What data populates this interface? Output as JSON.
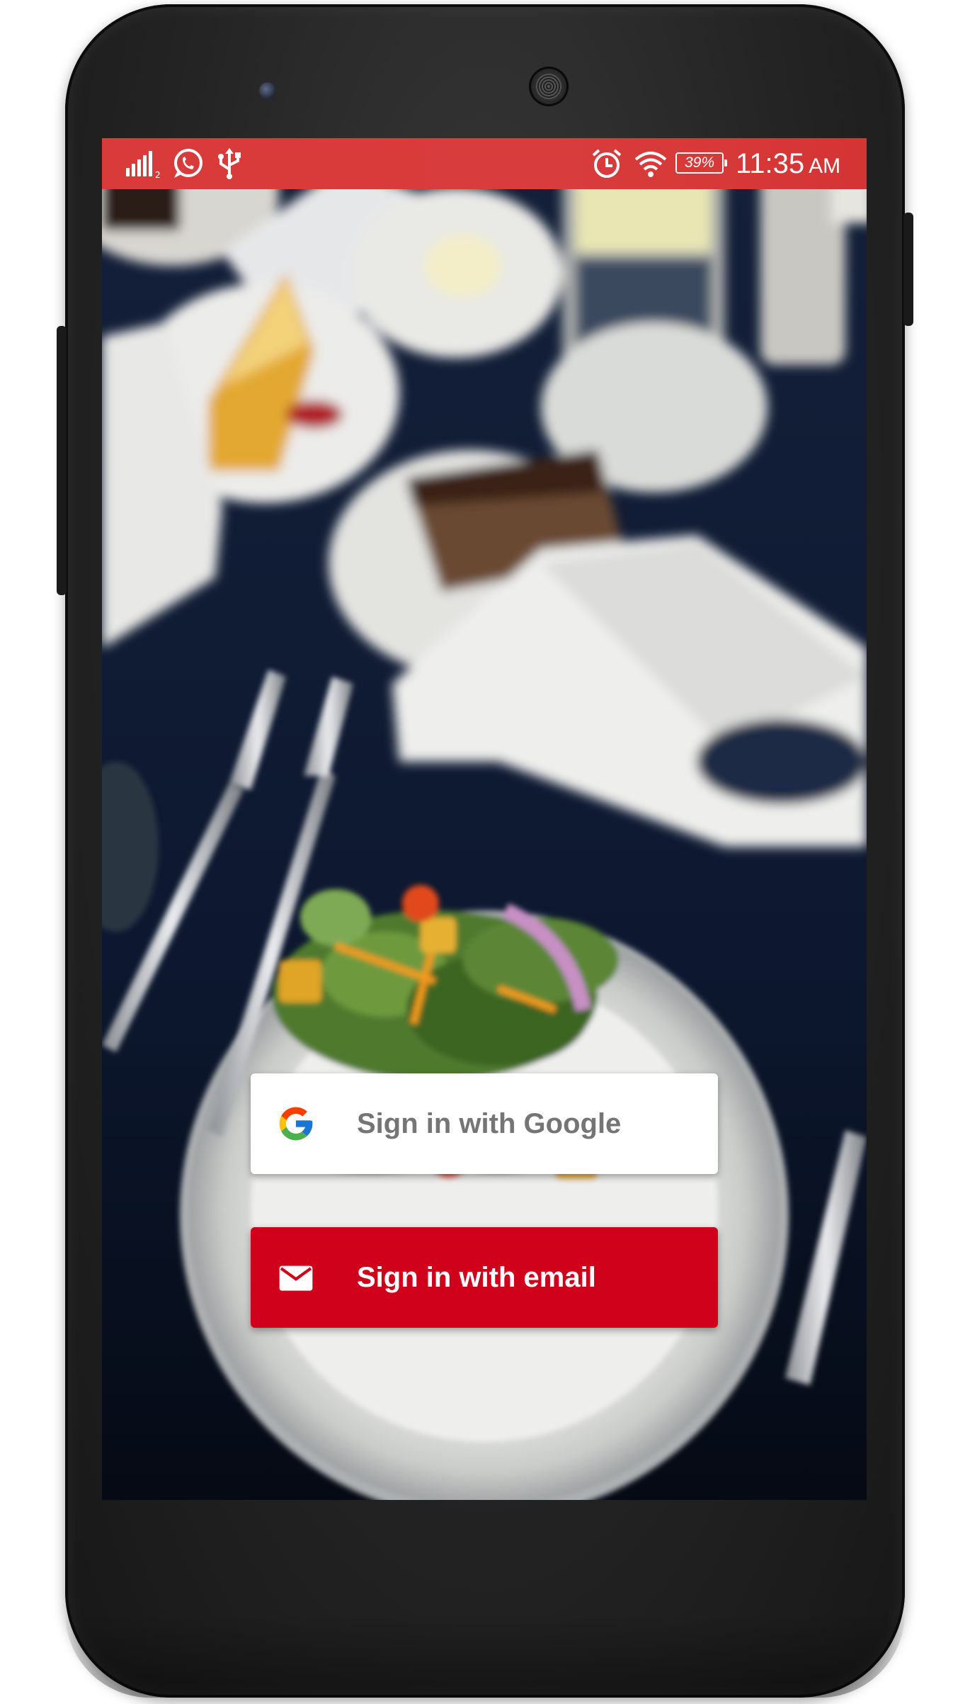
{
  "status_bar": {
    "battery": "39%",
    "time": "11:35",
    "ampm": "AM",
    "icons": [
      "signal-icon",
      "whatsapp-icon",
      "usb-icon",
      "alarm-icon",
      "wifi-icon",
      "battery-icon"
    ]
  },
  "login": {
    "google_label": "Sign in with Google",
    "email_label": "Sign in with email"
  },
  "colors": {
    "status_bar": "#d93a3a",
    "email_button": "#d0021b",
    "google_button": "#ffffff",
    "google_text": "#757575"
  }
}
